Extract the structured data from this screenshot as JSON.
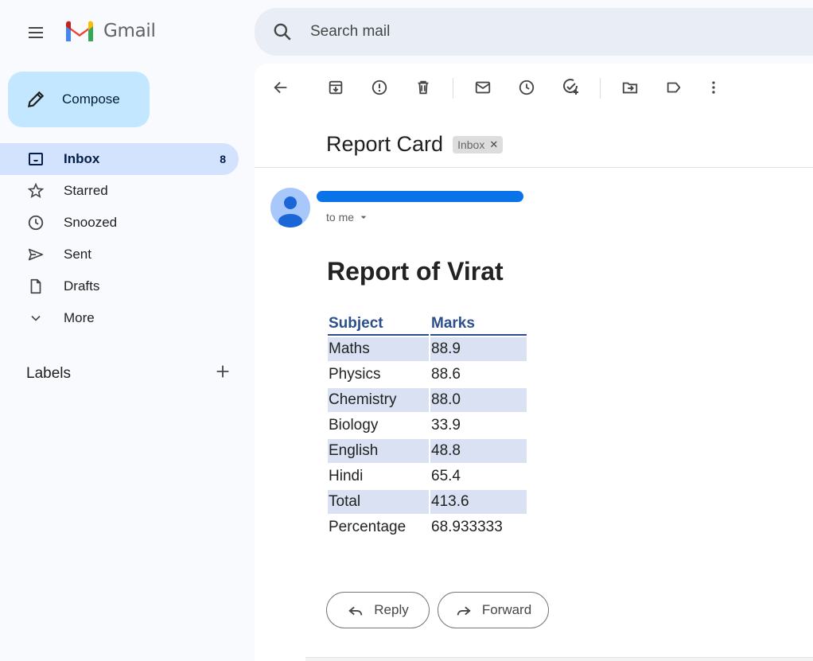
{
  "app": {
    "name": "Gmail"
  },
  "search": {
    "placeholder": "Search mail"
  },
  "compose": {
    "label": "Compose"
  },
  "nav": {
    "items": [
      {
        "label": "Inbox",
        "count": "8",
        "icon": "inbox-icon"
      },
      {
        "label": "Starred",
        "icon": "star-icon"
      },
      {
        "label": "Snoozed",
        "icon": "clock-icon"
      },
      {
        "label": "Sent",
        "icon": "send-icon"
      },
      {
        "label": "Drafts",
        "icon": "draft-icon"
      },
      {
        "label": "More",
        "icon": "chevron-down-icon"
      }
    ]
  },
  "labels": {
    "title": "Labels"
  },
  "email": {
    "subject": "Report Card",
    "badge": "Inbox",
    "to": "to me",
    "body_title": "Report of Virat",
    "table": {
      "headers": [
        "Subject",
        "Marks"
      ],
      "rows": [
        [
          "Maths",
          "88.9"
        ],
        [
          "Physics",
          "88.6"
        ],
        [
          "Chemistry",
          "88.0"
        ],
        [
          "Biology",
          "33.9"
        ],
        [
          "English",
          "48.8"
        ],
        [
          "Hindi",
          "65.4"
        ],
        [
          "Total",
          "413.6"
        ],
        [
          "Percentage",
          "68.933333"
        ]
      ]
    },
    "reply_label": "Reply",
    "forward_label": "Forward"
  },
  "colors": {
    "accent": "#c2e7ff",
    "active_nav": "#d3e3fd",
    "table_header": "#2b4f8c",
    "row_shade": "#d9e1f2",
    "redaction": "#0b73e8"
  }
}
